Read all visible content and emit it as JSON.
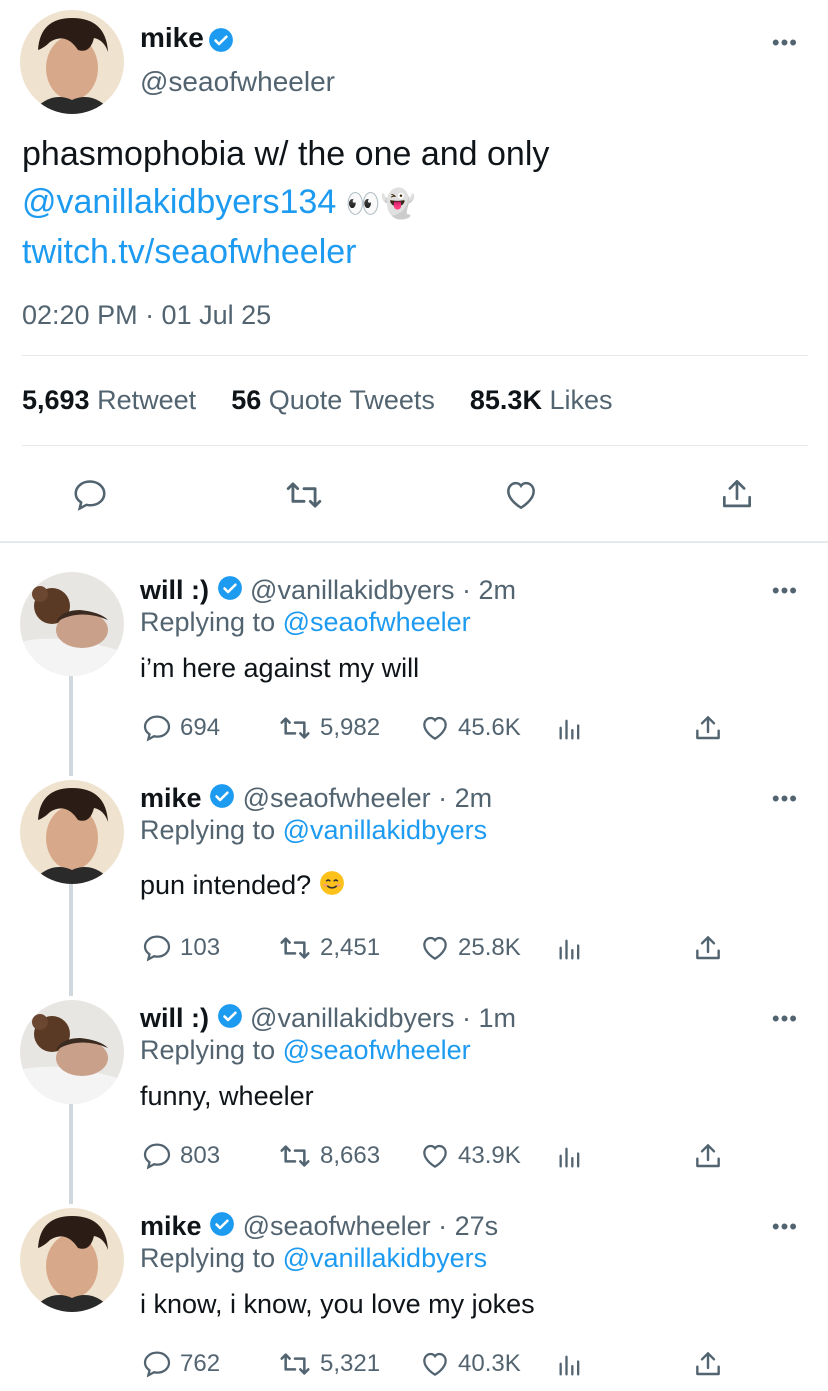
{
  "main_tweet": {
    "author_name": "mike",
    "author_handle": "@seaofwheeler",
    "text_line1": "phasmophobia w/ the one and only",
    "mention": "@vanillakidbyers134",
    "emojis": "👀👻",
    "link": "twitch.tv/seaofwheeler",
    "timestamp": "02:20 PM · 01 Jul 25",
    "stats": {
      "retweets_count": "5,693",
      "retweets_label": "Retweet",
      "quotes_count": "56",
      "quotes_label": "Quote Tweets",
      "likes_count": "85.3K",
      "likes_label": "Likes"
    }
  },
  "replies": [
    {
      "name": "will :)",
      "handle": "@vanillakidbyers",
      "time": "· 2m",
      "replying_prefix": "Replying to",
      "replying_to": "@seaofwheeler",
      "text": "i’m here against my will",
      "replies": "694",
      "retweets": "5,982",
      "likes": "45.6K"
    },
    {
      "name": "mike",
      "handle": "@seaofwheeler",
      "time": "· 2m",
      "replying_prefix": "Replying to",
      "replying_to": "@vanillakidbyers",
      "text": "pun intended?",
      "replies": "103",
      "retweets": "2,451",
      "likes": "25.8K"
    },
    {
      "name": "will :)",
      "handle": "@vanillakidbyers",
      "time": "· 1m",
      "replying_prefix": "Replying to",
      "replying_to": "@seaofwheeler",
      "text": "funny, wheeler",
      "replies": "803",
      "retweets": "8,663",
      "likes": "43.9K"
    },
    {
      "name": "mike",
      "handle": "@seaofwheeler",
      "time": "· 27s",
      "replying_prefix": "Replying to",
      "replying_to": "@vanillakidbyers",
      "text": "i know, i know, you love my jokes",
      "replies": "762",
      "retweets": "5,321",
      "likes": "40.3K"
    }
  ],
  "colors": {
    "accent": "#1d9bf0",
    "text": "#0f1419",
    "secondary": "#536471",
    "divider": "#e6e9ec"
  }
}
